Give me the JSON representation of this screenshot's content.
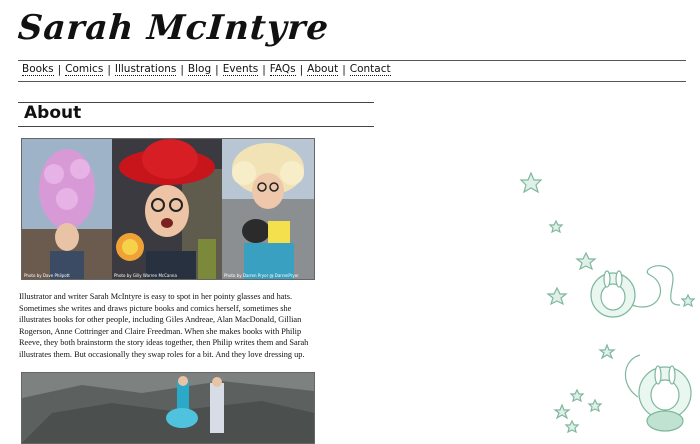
{
  "site": {
    "logo_text": "Sarah McIntyre"
  },
  "nav": [
    {
      "label": "Books"
    },
    {
      "label": "Comics"
    },
    {
      "label": "Illustrations"
    },
    {
      "label": "Blog"
    },
    {
      "label": "Events"
    },
    {
      "label": "FAQs"
    },
    {
      "label": "About"
    },
    {
      "label": "Contact"
    }
  ],
  "nav_separator": "|",
  "page": {
    "title": "About"
  },
  "photos": [
    {
      "credit": "Photo by Dave Philpott"
    },
    {
      "credit": "Photo by Gilly Warren McCanna"
    },
    {
      "credit": "Photo by Darren Pryor @ DarrenPryor"
    }
  ],
  "bio": "Illustrator and writer Sarah McIntyre is easy to spot in her pointy glasses and hats. Sometimes she writes and draws picture books and comics herself, sometimes she illustrates books for other people, including Giles Andreae, Alan MacDonald, Gillian Rogerson, Anne Cottringer and Claire Freedman. When she makes books with Philip Reeve, they both brainstorm the story ideas together, then Philip writes them and Sarah illustrates them. But occasionally they swap roles for a bit. And they love dressing up.",
  "colors": {
    "star": "#cfe8dc",
    "rabbit": "#bfe3d0"
  }
}
